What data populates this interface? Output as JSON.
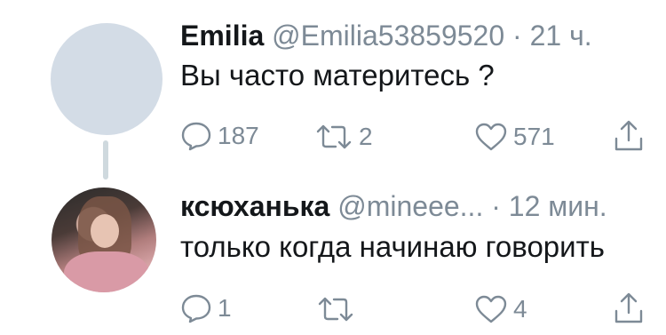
{
  "tweets": [
    {
      "author": "Emilia",
      "handle": "@Emilia53859520",
      "separator": "·",
      "time": "21 ч.",
      "text": "Вы часто материтесь ?",
      "replies": "187",
      "retweets": "2",
      "likes": "571"
    },
    {
      "author": "ксюханька",
      "handle": "@mineee...",
      "separator": "·",
      "time": "12 мин.",
      "text": "только когда начинаю говорить",
      "replies": "1",
      "retweets": "",
      "likes": "4"
    }
  ],
  "icons": {
    "reply": "reply-icon",
    "retweet": "retweet-icon",
    "like": "heart-icon",
    "share": "share-icon"
  },
  "colors": {
    "text": "#14171a",
    "muted": "#7d8a96",
    "avatar_placeholder": "#d3dce6",
    "thread_line": "#cfd9de"
  }
}
